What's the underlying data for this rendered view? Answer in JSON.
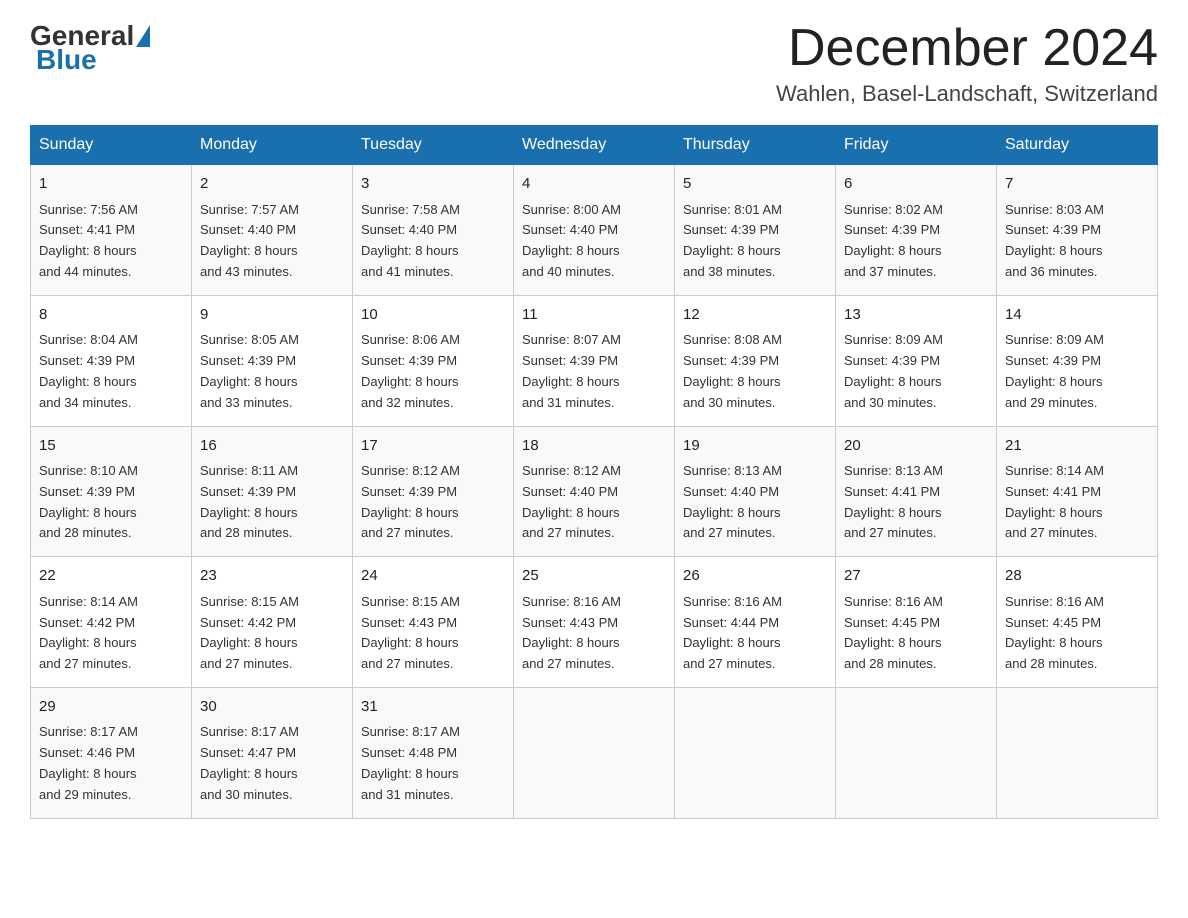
{
  "header": {
    "logo": {
      "part1": "General",
      "part2": "Blue"
    },
    "month": "December 2024",
    "location": "Wahlen, Basel-Landschaft, Switzerland"
  },
  "weekdays": [
    "Sunday",
    "Monday",
    "Tuesday",
    "Wednesday",
    "Thursday",
    "Friday",
    "Saturday"
  ],
  "weeks": [
    [
      {
        "day": "1",
        "sunrise": "7:56 AM",
        "sunset": "4:41 PM",
        "daylight": "8 hours and 44 minutes."
      },
      {
        "day": "2",
        "sunrise": "7:57 AM",
        "sunset": "4:40 PM",
        "daylight": "8 hours and 43 minutes."
      },
      {
        "day": "3",
        "sunrise": "7:58 AM",
        "sunset": "4:40 PM",
        "daylight": "8 hours and 41 minutes."
      },
      {
        "day": "4",
        "sunrise": "8:00 AM",
        "sunset": "4:40 PM",
        "daylight": "8 hours and 40 minutes."
      },
      {
        "day": "5",
        "sunrise": "8:01 AM",
        "sunset": "4:39 PM",
        "daylight": "8 hours and 38 minutes."
      },
      {
        "day": "6",
        "sunrise": "8:02 AM",
        "sunset": "4:39 PM",
        "daylight": "8 hours and 37 minutes."
      },
      {
        "day": "7",
        "sunrise": "8:03 AM",
        "sunset": "4:39 PM",
        "daylight": "8 hours and 36 minutes."
      }
    ],
    [
      {
        "day": "8",
        "sunrise": "8:04 AM",
        "sunset": "4:39 PM",
        "daylight": "8 hours and 34 minutes."
      },
      {
        "day": "9",
        "sunrise": "8:05 AM",
        "sunset": "4:39 PM",
        "daylight": "8 hours and 33 minutes."
      },
      {
        "day": "10",
        "sunrise": "8:06 AM",
        "sunset": "4:39 PM",
        "daylight": "8 hours and 32 minutes."
      },
      {
        "day": "11",
        "sunrise": "8:07 AM",
        "sunset": "4:39 PM",
        "daylight": "8 hours and 31 minutes."
      },
      {
        "day": "12",
        "sunrise": "8:08 AM",
        "sunset": "4:39 PM",
        "daylight": "8 hours and 30 minutes."
      },
      {
        "day": "13",
        "sunrise": "8:09 AM",
        "sunset": "4:39 PM",
        "daylight": "8 hours and 30 minutes."
      },
      {
        "day": "14",
        "sunrise": "8:09 AM",
        "sunset": "4:39 PM",
        "daylight": "8 hours and 29 minutes."
      }
    ],
    [
      {
        "day": "15",
        "sunrise": "8:10 AM",
        "sunset": "4:39 PM",
        "daylight": "8 hours and 28 minutes."
      },
      {
        "day": "16",
        "sunrise": "8:11 AM",
        "sunset": "4:39 PM",
        "daylight": "8 hours and 28 minutes."
      },
      {
        "day": "17",
        "sunrise": "8:12 AM",
        "sunset": "4:39 PM",
        "daylight": "8 hours and 27 minutes."
      },
      {
        "day": "18",
        "sunrise": "8:12 AM",
        "sunset": "4:40 PM",
        "daylight": "8 hours and 27 minutes."
      },
      {
        "day": "19",
        "sunrise": "8:13 AM",
        "sunset": "4:40 PM",
        "daylight": "8 hours and 27 minutes."
      },
      {
        "day": "20",
        "sunrise": "8:13 AM",
        "sunset": "4:41 PM",
        "daylight": "8 hours and 27 minutes."
      },
      {
        "day": "21",
        "sunrise": "8:14 AM",
        "sunset": "4:41 PM",
        "daylight": "8 hours and 27 minutes."
      }
    ],
    [
      {
        "day": "22",
        "sunrise": "8:14 AM",
        "sunset": "4:42 PM",
        "daylight": "8 hours and 27 minutes."
      },
      {
        "day": "23",
        "sunrise": "8:15 AM",
        "sunset": "4:42 PM",
        "daylight": "8 hours and 27 minutes."
      },
      {
        "day": "24",
        "sunrise": "8:15 AM",
        "sunset": "4:43 PM",
        "daylight": "8 hours and 27 minutes."
      },
      {
        "day": "25",
        "sunrise": "8:16 AM",
        "sunset": "4:43 PM",
        "daylight": "8 hours and 27 minutes."
      },
      {
        "day": "26",
        "sunrise": "8:16 AM",
        "sunset": "4:44 PM",
        "daylight": "8 hours and 27 minutes."
      },
      {
        "day": "27",
        "sunrise": "8:16 AM",
        "sunset": "4:45 PM",
        "daylight": "8 hours and 28 minutes."
      },
      {
        "day": "28",
        "sunrise": "8:16 AM",
        "sunset": "4:45 PM",
        "daylight": "8 hours and 28 minutes."
      }
    ],
    [
      {
        "day": "29",
        "sunrise": "8:17 AM",
        "sunset": "4:46 PM",
        "daylight": "8 hours and 29 minutes."
      },
      {
        "day": "30",
        "sunrise": "8:17 AM",
        "sunset": "4:47 PM",
        "daylight": "8 hours and 30 minutes."
      },
      {
        "day": "31",
        "sunrise": "8:17 AM",
        "sunset": "4:48 PM",
        "daylight": "8 hours and 31 minutes."
      },
      null,
      null,
      null,
      null
    ]
  ],
  "labels": {
    "sunrise": "Sunrise: ",
    "sunset": "Sunset: ",
    "daylight": "Daylight: "
  }
}
